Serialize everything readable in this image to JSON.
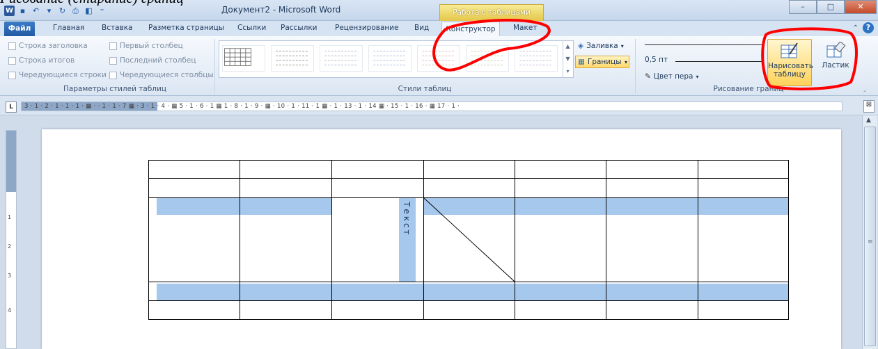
{
  "caption": "Рисование (стирание) границ",
  "title_bar": {
    "document_title": "Документ2 - Microsoft Word",
    "context_header": "Работа с таблицами",
    "window_buttons": [
      "–",
      "□",
      "✕"
    ]
  },
  "tabs": {
    "file": "Файл",
    "items": [
      "Главная",
      "Вставка",
      "Разметка страницы",
      "Ссылки",
      "Рассылки",
      "Рецензирование",
      "Вид"
    ],
    "context_tabs": [
      "Конструктор",
      "Макет"
    ]
  },
  "ribbon": {
    "table_style_options": {
      "label": "Параметры стилей таблиц",
      "checkboxes": [
        "Строка заголовка",
        "Первый столбец",
        "Строка итогов",
        "Последний столбец",
        "Чередующиеся строки",
        "Чередующиеся столбцы"
      ]
    },
    "table_styles": {
      "label": "Стили таблиц",
      "shading": "Заливка",
      "borders": "Границы"
    },
    "draw_borders": {
      "label": "Рисование границ",
      "pen_weight": "0,5 пт",
      "pen_color": "Цвет пера",
      "draw_table": "Нарисовать таблицу",
      "eraser": "Ластик"
    }
  },
  "ruler": {
    "corner": "L",
    "text": "3 · 1 · 2 · 1 · 1 · 1 · ▦ ·  · 1 · 1 · 7 ▦ · 3 · 1 · 4 · ▦ 5 · 1 · 6 · 1 ▦ 1 · 8 · 1 · 9 · ▦ · 10 · 1 · 11 · 1 ▦ · 1 · 13 · 1 · 14 ▦ · 15 · 1 · 16 · ▦ 17 · 1 ·",
    "vertical_numbers": [
      "1",
      "2",
      "3",
      "4"
    ]
  },
  "table": {
    "vertical_text": "Текст",
    "columns": 7,
    "rows": 5
  },
  "colors": {
    "highlight": "#a6c8ec",
    "annotation": "#ff0000",
    "ribbon_active": "#ffd86a"
  }
}
